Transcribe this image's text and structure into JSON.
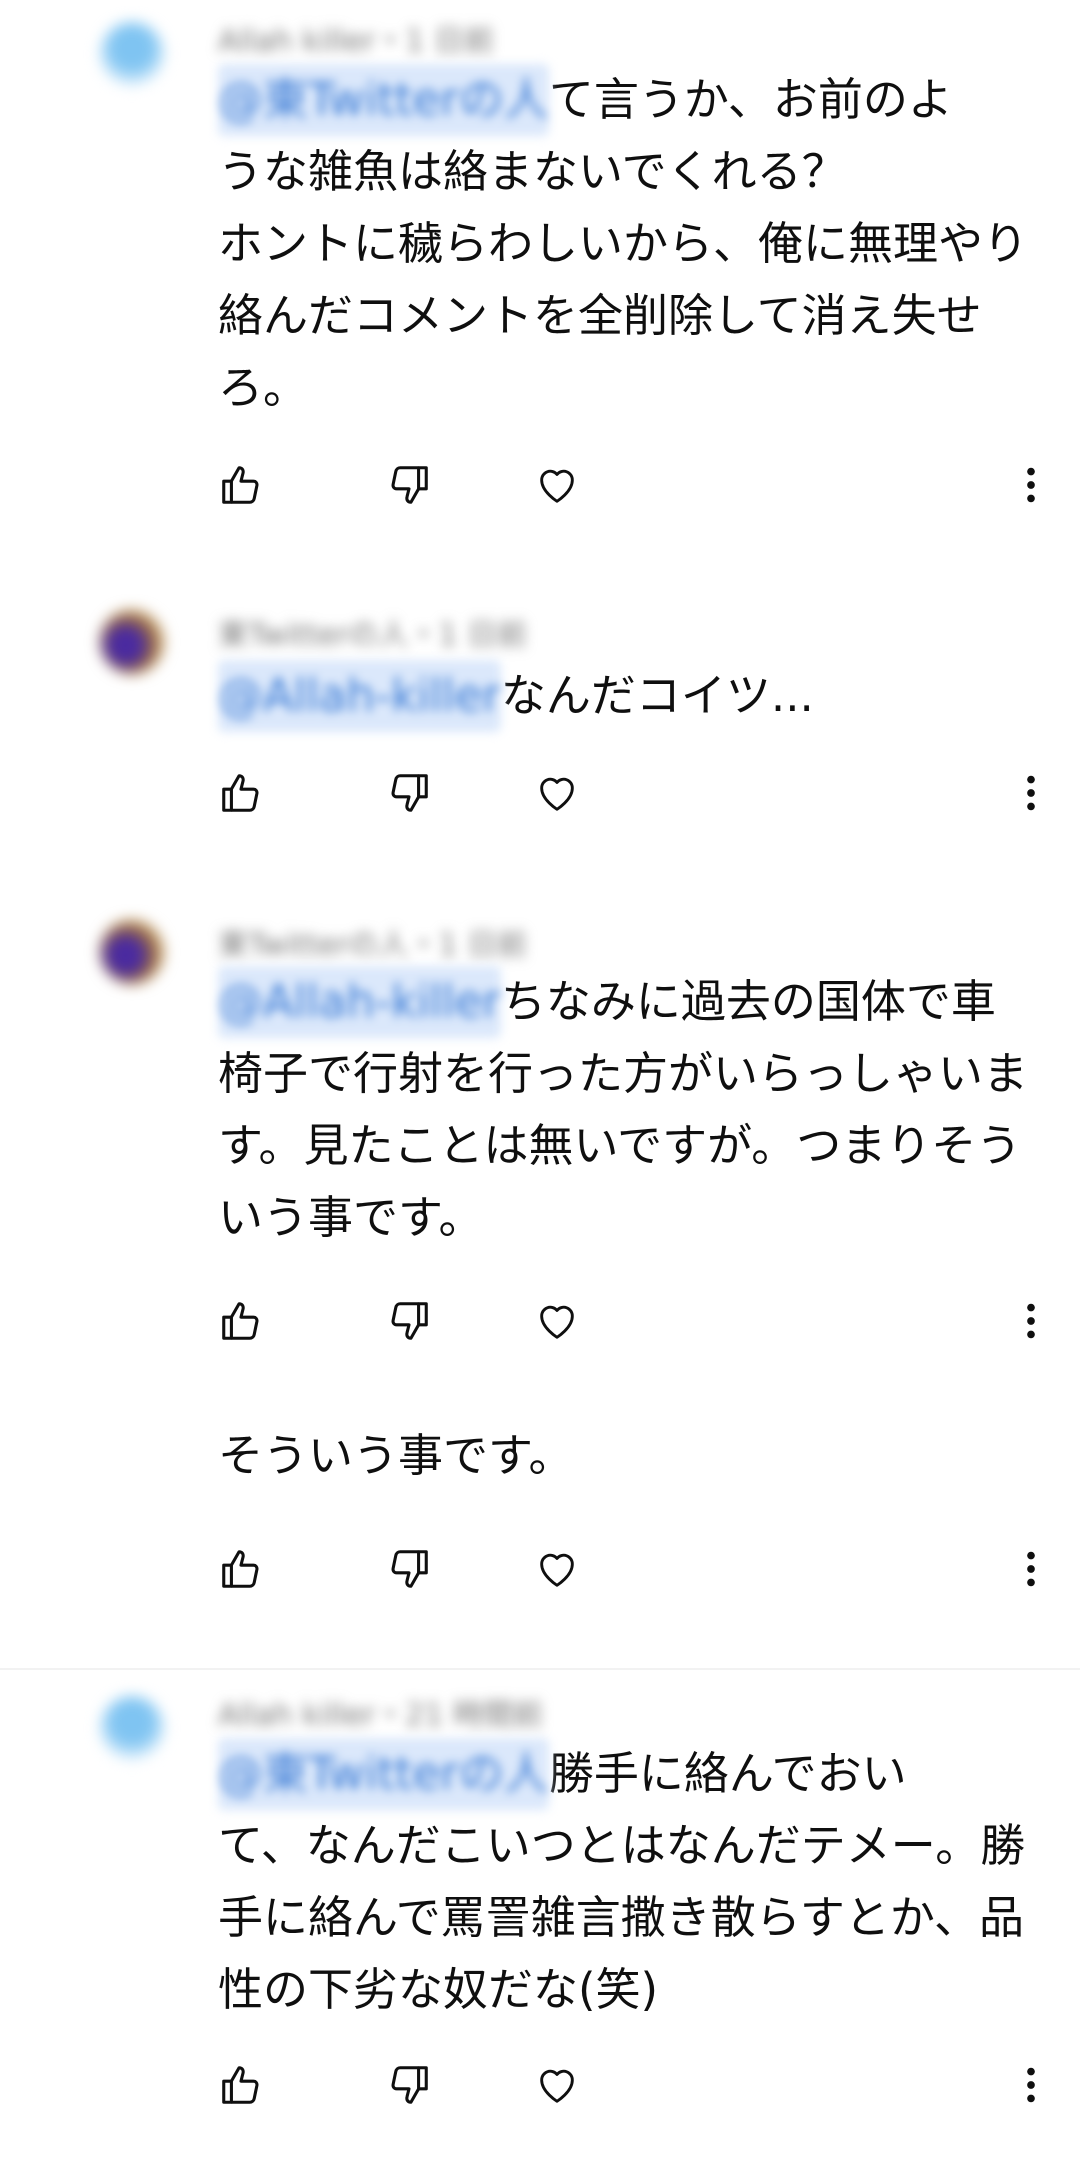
{
  "comments": [
    {
      "meta": "Allah killer・1 日前",
      "mention": "@東Twitterの人",
      "text_first": "て言うか、お前のよ",
      "text_rest": "うな雑魚は絡まないでくれる？\nホントに穢らわしいから、俺に無理やり絡んだコメントを全削除して消え失せろ。"
    },
    {
      "meta": "東Twitterの人・1 日前",
      "mention": "@Allah-killer",
      "text_first": "なんだコイツ...",
      "text_rest": ""
    },
    {
      "meta": "東Twitterの人・1 日前",
      "mention": "@Allah-killer",
      "text_first": "ちなみに過去の国体で車",
      "text_rest": "椅子で行射を行った方がいらっしゃいます。見たことは無いですが。つまりそういう事です。"
    },
    {
      "meta": "",
      "mention": "",
      "text_first": "そういう事です。",
      "text_rest": ""
    },
    {
      "meta": "Allah killer・21 時間前",
      "mention": "@東Twitterの人",
      "text_first": "勝手に絡んでおい",
      "text_rest": "て、なんだこいつとはなんだテメー。勝手に絡んで罵詈雑言撒き散らすとか、品性の下劣な奴だな(笑)"
    }
  ],
  "icons": [
    "like-icon",
    "dislike-icon",
    "heart-icon",
    "more-vert-icon"
  ]
}
